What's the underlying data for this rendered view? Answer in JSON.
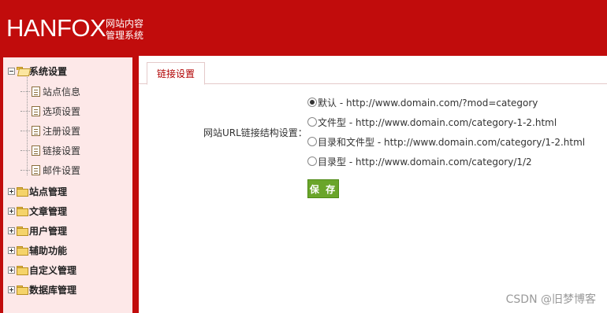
{
  "header": {
    "logo": "HANFOX",
    "subtitle_line1": "网站内容",
    "subtitle_line2": "管理系统",
    "bg_color": "#c10c0c"
  },
  "sidebar": {
    "expanded_group": {
      "label": "系统设置",
      "icon": "folder-open-icon",
      "children": [
        {
          "label": "站点信息",
          "icon": "document-icon"
        },
        {
          "label": "选项设置",
          "icon": "document-icon"
        },
        {
          "label": "注册设置",
          "icon": "document-icon"
        },
        {
          "label": "链接设置",
          "icon": "document-icon"
        },
        {
          "label": "邮件设置",
          "icon": "document-icon"
        }
      ]
    },
    "groups": [
      {
        "label": "站点管理",
        "icon": "folder-icon"
      },
      {
        "label": "文章管理",
        "icon": "folder-icon"
      },
      {
        "label": "用户管理",
        "icon": "folder-icon"
      },
      {
        "label": "辅助功能",
        "icon": "folder-icon"
      },
      {
        "label": "自定义管理",
        "icon": "folder-icon"
      },
      {
        "label": "数据库管理",
        "icon": "folder-icon"
      }
    ]
  },
  "main": {
    "tab_label": "链接设置",
    "form_label": "网站URL链接结构设置：",
    "options": [
      {
        "label": "默认 - http://www.domain.com/?mod=category",
        "checked": true
      },
      {
        "label": "文件型 - http://www.domain.com/category-1-2.html",
        "checked": false
      },
      {
        "label": "目录和文件型 - http://www.domain.com/category/1-2.html",
        "checked": false
      },
      {
        "label": "目录型 - http://www.domain.com/category/1/2",
        "checked": false
      }
    ],
    "save_label": "保 存",
    "accent_color": "#6aa52a"
  },
  "watermark": "CSDN @旧梦博客"
}
